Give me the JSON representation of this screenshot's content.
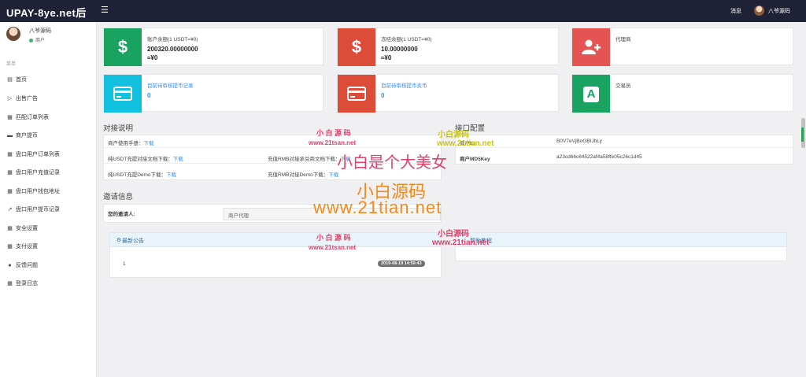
{
  "header": {
    "brand": "UPAY-8ye.net后",
    "menu_icon": "menu-icon",
    "messages": "消息",
    "user": "八爷源码"
  },
  "profile": {
    "name": "八爷源码",
    "role": "商户"
  },
  "sidebar": {
    "section": "菜单",
    "items": [
      {
        "icon": "chart-icon",
        "label": "首页"
      },
      {
        "icon": "megaphone-icon",
        "label": "出售广告"
      },
      {
        "icon": "list-icon",
        "label": "匹配订单列表"
      },
      {
        "icon": "card-icon",
        "label": "商户提币"
      },
      {
        "icon": "list-icon",
        "label": "盘口用户订单列表"
      },
      {
        "icon": "list-icon",
        "label": "盘口用户充值记录"
      },
      {
        "icon": "list-icon",
        "label": "盘口用户钱包地址"
      },
      {
        "icon": "external-icon",
        "label": "盘口用户提币记录"
      },
      {
        "icon": "list-icon",
        "label": "安全设置"
      },
      {
        "icon": "list-icon",
        "label": "支付设置"
      },
      {
        "icon": "chat-icon",
        "label": "反馈问题"
      },
      {
        "icon": "list-icon",
        "label": "登录日志"
      }
    ]
  },
  "cards": {
    "balance": {
      "label": "账户余额(1 USDT=¥0)",
      "value": "200320.00000000",
      "sub": "≈¥0",
      "icon": "dollar-icon",
      "color": "#1aa260"
    },
    "frozen": {
      "label": "冻结余额(1 USDT=¥0)",
      "value": "10.00000000",
      "sub": "≈¥0",
      "icon": "dollar-icon",
      "color": "#dd4b39"
    },
    "agent": {
      "label": "代理商",
      "icon": "add-user-icon",
      "color": "#e55353"
    },
    "pending_withdraw": {
      "label": "目前待审核提币记录",
      "value": "0",
      "icon": "credit-card-icon",
      "color": "#12c0e0"
    },
    "pending_sell": {
      "label": "目前待审核提币卖币",
      "value": "0",
      "icon": "credit-card-icon",
      "color": "#dd4b39"
    },
    "trader": {
      "label": "交易员",
      "icon": "a-letter-icon",
      "color": "#1aa260"
    }
  },
  "docs": {
    "title": "对接说明",
    "download": "下载",
    "manual": "商户使用手册：",
    "usdt_doc": "纯USDT充提对接文档下载：",
    "rmb_doc": "充值RMB对接承兑商文档下载：",
    "usdt_demo": "纯USDT充提Demo下载：",
    "rmb_demo": "充值RMB对接Demo下载："
  },
  "api": {
    "title": "接口配置",
    "merchant_id_label": "商户ID",
    "merchant_id_value": "B0V7eVjBoGBIJhLy",
    "md5_label": "商户MD5Key",
    "md5_value": "a23cd66c64522af4a58ffe05c26c1d45"
  },
  "invite": {
    "title": "邀请信息",
    "inviter_label": "您的邀请人:",
    "inviter_value": "商户代理"
  },
  "notice": {
    "title": "最新公告",
    "icon": "gears-icon",
    "item_title": "1",
    "item_time": "2019-08-19 14:59:43"
  },
  "help": {
    "title": "帮助教程"
  },
  "watermarks": {
    "brand": "小白源码",
    "brand_spaced": "小 白 源 码",
    "site": "www.21tian.net",
    "site_alt": "www.21tsan.net",
    "slogan": "小白是个大美女"
  }
}
